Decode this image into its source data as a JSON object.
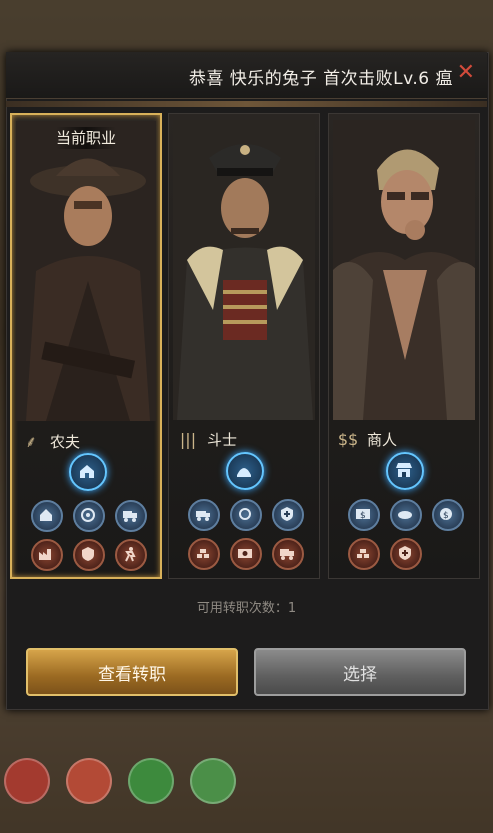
{
  "notification": {
    "text": "恭喜 快乐的兔子 首次击败Lv.6 瘟",
    "close_icon": "close-x-icon"
  },
  "cards": [
    {
      "selected": true,
      "current_label": "当前职业",
      "job_name": "农夫",
      "job_icon": "wheat-icon",
      "main_skill": "farm-barn-icon",
      "row1": [
        "farm-house-icon",
        "gear-wheel-icon",
        "truck-icon"
      ],
      "row2": [
        "factory-icon",
        "food-shield-icon",
        "running-worker-icon"
      ]
    },
    {
      "selected": false,
      "job_name": "斗士",
      "job_icon": "bullets-icon",
      "main_skill": "armory-dome-icon",
      "row1": [
        "supply-truck-icon",
        "cycle-arrows-icon",
        "shield-plus-icon"
      ],
      "row2": [
        "gold-bars-icon",
        "money-bill-icon",
        "delivery-truck-icon"
      ]
    },
    {
      "selected": false,
      "job_name": "商人",
      "job_icon": "dollars-icon",
      "main_skill": "market-shop-icon",
      "row1": [
        "cash-icon",
        "bread-icon",
        "coin-plus-icon"
      ],
      "row2": [
        "gold-bars-icon",
        "trade-shield-icon"
      ]
    }
  ],
  "available_changes": "可用转职次数：1",
  "buttons": {
    "view": "查看转职",
    "select": "选择"
  },
  "colors": {
    "selected_border": "#d8b15a",
    "skill_glow": "#64c6ff",
    "close": "#d24b3b"
  }
}
